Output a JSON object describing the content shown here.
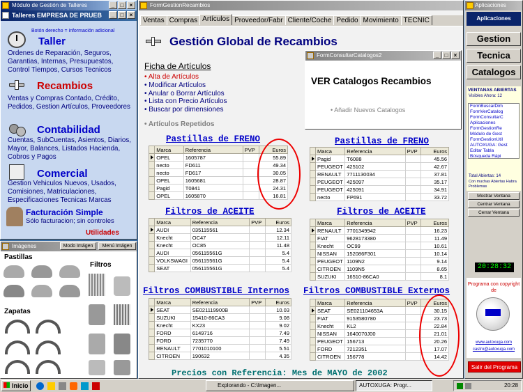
{
  "desktop": {
    "bg": "#3a6ea5",
    "accent": "#0000c8",
    "red": "#cc0000"
  },
  "left_win": {
    "title": "Módulo de Gestión de Talleres",
    "subtitle": "Talleres EMPRESA DE PRUEB",
    "hint": "Botón derecho = información adicional",
    "taller": {
      "title": "Taller",
      "items": "Ordenes de Reparación, Seguros, Garantias, Internas, Presupuestos, Control Tiempos, Cursos Tecnicos"
    },
    "recambios": {
      "title": "Recambios",
      "items": "Ventas y Compras Contado, Crédito, Pedidos, Gestion Artículos, Proveedores"
    },
    "contabilidad": {
      "title": "Contabilidad",
      "items": "Cuentas, SubCuentas, Asientos, Diarios, Mayor, Balances, Listados Hacienda, Cobros y Pagos"
    },
    "comercial": {
      "title": "Comercial",
      "items": "Gestion Vehiculos Nuevos, Usados, Comisiones, Matriculaciones, Especificaciones Tecnicas Marcas"
    },
    "facturacion": {
      "title": "Facturación Simple",
      "items": "Sólo facturacion; sin controles"
    },
    "utilidades": "Utilidades"
  },
  "images_win": {
    "title": "Imágenes",
    "mode": "Modo Imágen",
    "menu": "Menú Imágen",
    "label_pastillas": "Pastillas",
    "label_filtros": "Filtros",
    "label_zapatas": "Zapatas"
  },
  "main_win": {
    "title": "FormGestionRecambios",
    "tabs": [
      "Ventas",
      "Compras",
      "Artículos",
      "Proveedor/Fabr",
      "Cliente/Coche",
      "Pedido",
      "Movimiento",
      "TECNIC"
    ],
    "heading": "Gestión Global de Recambios",
    "fichas": {
      "title": "Ficha de Artículos",
      "items": [
        "Alta de Artículos",
        "Modificar Artículos",
        "Anular o Borrar Artículos",
        "Lista con Precio Artículos",
        "Buscar por dimensiones"
      ],
      "repetidos": "Artículos Repetidos"
    },
    "catalog": {
      "title": "FormConsultarCatalogos2",
      "heading": "VER Catalogos Recambios",
      "item": "Añadir Nuevos Catalogos"
    },
    "columns": [
      "Marca",
      "Referencia",
      "PVP",
      "Euros"
    ],
    "tables": {
      "frenoL": {
        "title": "Pastillas de FRENO",
        "rows": [
          [
            "OPEL",
            "1605787",
            "",
            "55.89"
          ],
          [
            "necto",
            "FD611",
            "",
            "49.34"
          ],
          [
            "necto",
            "FD617",
            "",
            "30.05"
          ],
          [
            "OPEL",
            "1605681",
            "",
            "28.87"
          ],
          [
            "Pagid",
            "T0841",
            "",
            "24.31"
          ],
          [
            "OPEL",
            "1605870",
            "",
            "16.81"
          ]
        ]
      },
      "frenoR": {
        "title": "Pastillas de FRENO",
        "rows": [
          [
            "Pagid",
            "T6088",
            "",
            "45.56"
          ],
          [
            "PEUGEOT",
            "425102",
            "",
            "42.67"
          ],
          [
            "RENAULT",
            "7711130034",
            "",
            "37.81"
          ],
          [
            "PEUGEOT",
            "425097",
            "",
            "35.17"
          ],
          [
            "PEUGEOT",
            "425091",
            "",
            "34.91"
          ],
          [
            "necto",
            "FP691",
            "",
            "33.72"
          ]
        ]
      },
      "aceiteL": {
        "title": "Filtros de ACEITE",
        "rows": [
          [
            "AUDI",
            "035115561",
            "",
            "12.34"
          ],
          [
            "Knecht",
            "OC47",
            "",
            "12.11"
          ],
          [
            "Knecht",
            "OC85",
            "",
            "11.48"
          ],
          [
            "AUDI",
            "056115561G",
            "",
            "5.4"
          ],
          [
            "VOLKSWAGI",
            "056115561G",
            "",
            "5.4"
          ],
          [
            "SEAT",
            "056115561G",
            "",
            "5.4"
          ]
        ]
      },
      "aceiteR": {
        "title": "Filtros de ACEITE",
        "rows": [
          [
            "RENAULT",
            "7701349942",
            "",
            "16.23"
          ],
          [
            "FIAT",
            "9628173380",
            "",
            "11.49"
          ],
          [
            "Knecht",
            "OC99",
            "",
            "10.61"
          ],
          [
            "NISSAN",
            "152086F301",
            "",
            "10.14"
          ],
          [
            "PEUGEOT",
            "1109N2",
            "",
            "9.14"
          ],
          [
            "CITROEN",
            "1109N5",
            "",
            "8.65"
          ],
          [
            "SUZUKI",
            "16510-86CA0",
            "",
            "8.1"
          ]
        ]
      },
      "combL": {
        "title": "Filtros COMBUSTIBLE Internos",
        "rows": [
          [
            "SEAT",
            "SE021119900B",
            "",
            "10.03"
          ],
          [
            "SUZUKI",
            "15410-86CA3",
            "",
            "9.08"
          ],
          [
            "Knecht",
            "KX23",
            "",
            "9.02"
          ],
          [
            "FORD",
            "6149716",
            "",
            "7.49"
          ],
          [
            "FORD",
            "7235770",
            "",
            "7.49"
          ],
          [
            "RENAULT",
            "7701010100",
            "",
            "5.51"
          ],
          [
            "CITROEN",
            "190632",
            "",
            "4.35"
          ]
        ]
      },
      "combR": {
        "title": "Filtros COMBUSTIBLE Externos",
        "rows": [
          [
            "SEAT",
            "SE021104653A",
            "",
            "30.15"
          ],
          [
            "FIAT",
            "9153580780",
            "",
            "23.73"
          ],
          [
            "Knecht",
            "KL2",
            "",
            "22.84"
          ],
          [
            "NISSAN",
            "1640070J00",
            "",
            "21.01"
          ],
          [
            "PEUGEOT",
            "156713",
            "",
            "20.26"
          ],
          [
            "FORD",
            "7212351",
            "",
            "17.07"
          ],
          [
            "CITROEN",
            "156778",
            "",
            "14.42"
          ]
        ]
      }
    },
    "footer": "Precios con Referencia: Mes de MAYO de 2002"
  },
  "right_win": {
    "title": "Aplicaciones",
    "header": "Aplicaciones",
    "buttons": [
      "Gestion",
      "Tecnica",
      "Catalogos"
    ],
    "ventanas_title": "VENTANAS ABIERTAS",
    "visibles": "Visibles Ahora: 12",
    "list": [
      "FormBuscarDim",
      "FormVerCatalog",
      "FormConsultarC",
      "Aplicaciones",
      "FormGestionRe",
      "Módulo de Gest",
      "FormGestionUtil",
      "AUTOXUGA: Gest",
      "Editar Tabla",
      "Búsqueda Rápi"
    ],
    "total": "Total Abiertas: 14",
    "problems": "Con muchas Abiertas Habra Problemas",
    "actions": [
      "Mostrar Ventana",
      "Centrar Ventana",
      "Cerrar Ventana"
    ],
    "clock": "20:28:32",
    "copyright": "Programa con copyright de",
    "web": "www.autoxuga.com",
    "email": "castro@autoxuga.com",
    "exit": "Salir del Programa"
  },
  "taskbar": {
    "start": "Inicio",
    "tasks": [
      "Explorando - C:\\Imagen...",
      "AUTOXUGA: Progr..."
    ],
    "time": "20:28"
  }
}
